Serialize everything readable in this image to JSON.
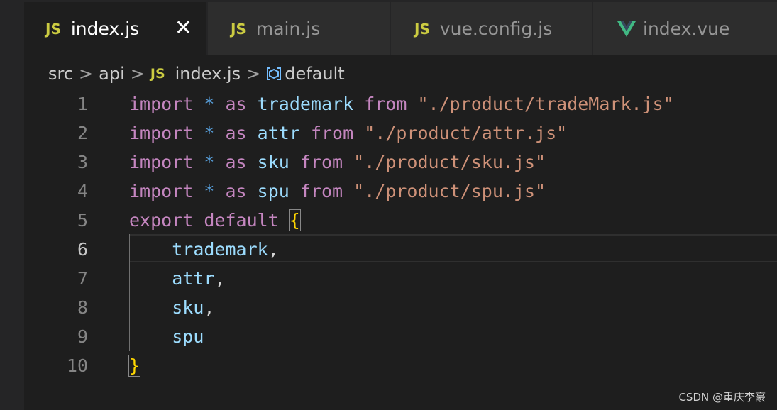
{
  "tabs": [
    {
      "icon": "JS",
      "label": "index.js",
      "active": true,
      "close": "✕"
    },
    {
      "icon": "JS",
      "label": "main.js",
      "active": false
    },
    {
      "icon": "JS",
      "label": "vue.config.js",
      "active": false
    },
    {
      "icon": "vue-icon",
      "label": "index.vue",
      "active": false
    }
  ],
  "breadcrumb": {
    "parts": [
      "src",
      "api"
    ],
    "file_icon": "JS",
    "file": "index.js",
    "symbol_icon": "object-symbol-icon",
    "symbol": "default",
    "separator": ">"
  },
  "editor": {
    "current_line": 6,
    "lines": [
      {
        "n": "1",
        "tokens": [
          [
            "kw-im",
            "import"
          ],
          [
            "pun",
            " "
          ],
          [
            "op",
            "*"
          ],
          [
            "pun",
            " "
          ],
          [
            "kw-im",
            "as"
          ],
          [
            "pun",
            " "
          ],
          [
            "id",
            "trademark"
          ],
          [
            "pun",
            " "
          ],
          [
            "kw-im",
            "from"
          ],
          [
            "pun",
            " "
          ],
          [
            "str",
            "\"./product/tradeMark.js\""
          ]
        ]
      },
      {
        "n": "2",
        "tokens": [
          [
            "kw-im",
            "import"
          ],
          [
            "pun",
            " "
          ],
          [
            "op",
            "*"
          ],
          [
            "pun",
            " "
          ],
          [
            "kw-im",
            "as"
          ],
          [
            "pun",
            " "
          ],
          [
            "id",
            "attr"
          ],
          [
            "pun",
            " "
          ],
          [
            "kw-im",
            "from"
          ],
          [
            "pun",
            " "
          ],
          [
            "str",
            "\"./product/attr.js\""
          ]
        ]
      },
      {
        "n": "3",
        "tokens": [
          [
            "kw-im",
            "import"
          ],
          [
            "pun",
            " "
          ],
          [
            "op",
            "*"
          ],
          [
            "pun",
            " "
          ],
          [
            "kw-im",
            "as"
          ],
          [
            "pun",
            " "
          ],
          [
            "id",
            "sku"
          ],
          [
            "pun",
            " "
          ],
          [
            "kw-im",
            "from"
          ],
          [
            "pun",
            " "
          ],
          [
            "str",
            "\"./product/sku.js\""
          ]
        ]
      },
      {
        "n": "4",
        "tokens": [
          [
            "kw-im",
            "import"
          ],
          [
            "pun",
            " "
          ],
          [
            "op",
            "*"
          ],
          [
            "pun",
            " "
          ],
          [
            "kw-im",
            "as"
          ],
          [
            "pun",
            " "
          ],
          [
            "id",
            "spu"
          ],
          [
            "pun",
            " "
          ],
          [
            "kw-im",
            "from"
          ],
          [
            "pun",
            " "
          ],
          [
            "str",
            "\"./product/spu.js\""
          ]
        ]
      },
      {
        "n": "5",
        "tokens": [
          [
            "kw-im",
            "export"
          ],
          [
            "pun",
            " "
          ],
          [
            "kw-im",
            "default"
          ],
          [
            "pun",
            " "
          ],
          [
            "br",
            "{"
          ]
        ]
      },
      {
        "n": "6",
        "tokens": [
          [
            "pun",
            "    "
          ],
          [
            "id",
            "trademark"
          ],
          [
            "pun",
            ","
          ]
        ]
      },
      {
        "n": "7",
        "tokens": [
          [
            "pun",
            "    "
          ],
          [
            "id",
            "attr"
          ],
          [
            "pun",
            ","
          ]
        ]
      },
      {
        "n": "8",
        "tokens": [
          [
            "pun",
            "    "
          ],
          [
            "id",
            "sku"
          ],
          [
            "pun",
            ","
          ]
        ]
      },
      {
        "n": "9",
        "tokens": [
          [
            "pun",
            "    "
          ],
          [
            "id",
            "spu"
          ]
        ]
      },
      {
        "n": "10",
        "tokens": [
          [
            "br",
            "}"
          ]
        ]
      }
    ]
  },
  "watermark": "CSDN @重庆李豪",
  "colors": {
    "keyword": "#c586c0",
    "operator": "#569cd6",
    "identifier": "#9cdcfe",
    "string": "#ce9178",
    "js_icon": "#cbcb41",
    "vue_green": "#41b883"
  }
}
